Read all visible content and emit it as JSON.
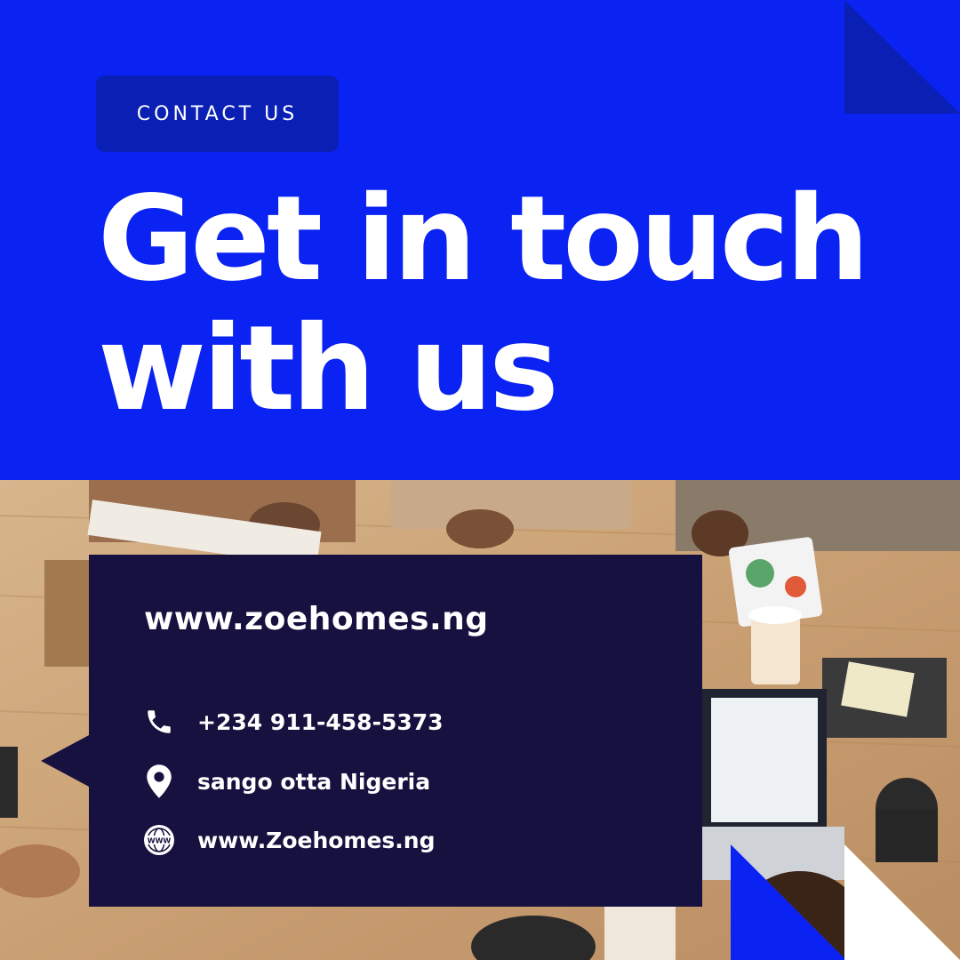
{
  "badge": {
    "label": "CONTACT US"
  },
  "headline": {
    "line1": "Get in touch",
    "line2": "with us"
  },
  "card": {
    "site": "www.zoehomes.ng",
    "phone": "+234 911-458-5373",
    "location": "sango otta Nigeria",
    "website": "www.Zoehomes.ng"
  },
  "icons": {
    "phone": "phone-icon",
    "location": "map-pin-icon",
    "website": "globe-www-icon"
  },
  "colors": {
    "primary_blue": "#0a22f2",
    "badge_blue": "#0a1fb4",
    "card_navy": "#16113f",
    "text": "#ffffff"
  }
}
